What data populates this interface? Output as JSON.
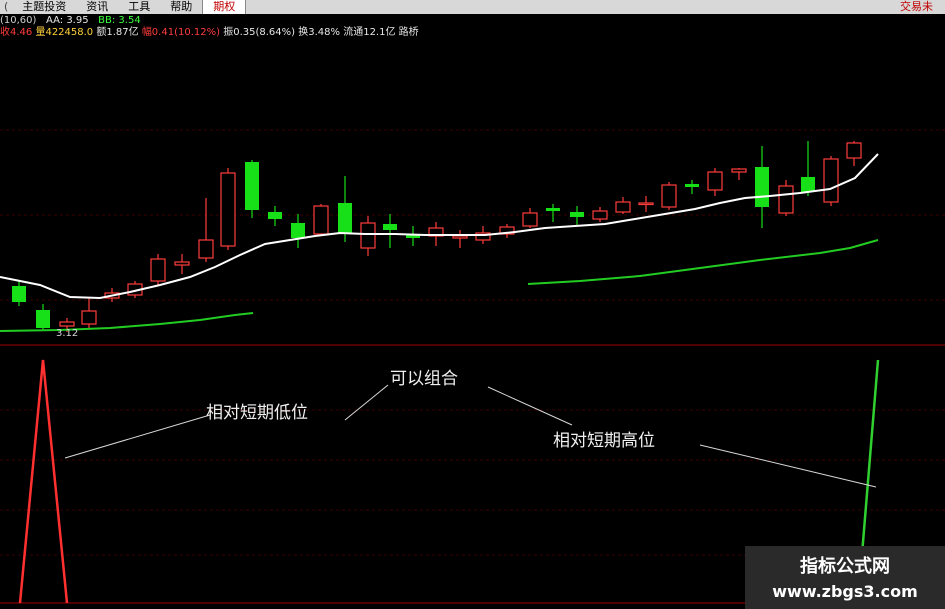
{
  "menu": {
    "lead": "(",
    "items": [
      "主题投资",
      "资讯",
      "工具",
      "帮助"
    ],
    "active": "期权",
    "trade": "交易未"
  },
  "indicator": {
    "params": "(10,60)",
    "aa_label": "AA: 3.95",
    "bb_label": "BB: 3.54"
  },
  "stats": {
    "close": "收4.46",
    "volume": "量422458.0",
    "amount": "额1.87亿",
    "change": "幅0.41(10.12%)",
    "amplitude": "振0.35(8.64%)",
    "turnover": "换3.48%",
    "float": "流通12.1亿",
    "name": "路桥"
  },
  "chart": {
    "low_label": "3.12",
    "colors": {
      "up": "#ff3c3c",
      "down": "#18e018",
      "ma_short": "#ffffff",
      "ma_long": "#22cc22",
      "signal_low": "#ff3030",
      "signal_high": "#30d030",
      "separator": "#a00000"
    }
  },
  "annotations": {
    "combine": "可以组合",
    "relative_low": "相对短期低位",
    "relative_high": "相对短期高位"
  },
  "watermark": {
    "line1": "指标公式网",
    "line2": "www.zbgs3.com"
  }
}
